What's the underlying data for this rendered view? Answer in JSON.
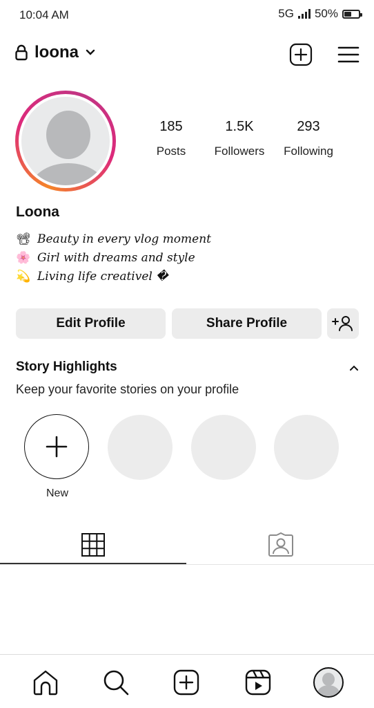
{
  "status_bar": {
    "time": "10:04 AM",
    "network": "5G",
    "battery_text": "50%",
    "battery_level": 0.5
  },
  "header": {
    "username": "loona",
    "icons": [
      "lock-icon",
      "chevron-down-icon",
      "add-post-icon",
      "menu-icon"
    ]
  },
  "profile": {
    "display_name": "Loona",
    "stats": [
      {
        "value": "185",
        "label": "Posts"
      },
      {
        "value": "1.5K",
        "label": "Followers"
      },
      {
        "value": "293",
        "label": "Following"
      }
    ],
    "bio": [
      {
        "emoji": "📽",
        "text": "Beauty in every vlog moment"
      },
      {
        "emoji": "🌸",
        "text": "Girl with dreams and style"
      },
      {
        "emoji": "💫",
        "text": "Living life creativel �"
      }
    ],
    "ring_colors": [
      "#f58529",
      "#dd2a7b",
      "#c13584"
    ]
  },
  "actions": {
    "edit_label": "Edit Profile",
    "share_label": "Share Profile",
    "add_person_icon": "add-person-icon"
  },
  "highlights": {
    "title": "Story Highlights",
    "subtitle": "Keep your favorite stories on your profile",
    "new_label": "New",
    "placeholder_count": 3
  },
  "tabs": [
    {
      "name": "grid",
      "icon": "grid-icon",
      "selected": true
    },
    {
      "name": "tagged",
      "icon": "tagged-person-icon",
      "selected": false
    }
  ],
  "bottom_nav": [
    {
      "name": "home",
      "icon": "home-icon"
    },
    {
      "name": "search",
      "icon": "search-icon"
    },
    {
      "name": "create",
      "icon": "create-icon"
    },
    {
      "name": "reels",
      "icon": "reels-icon"
    },
    {
      "name": "profile",
      "icon": "profile-avatar"
    }
  ]
}
